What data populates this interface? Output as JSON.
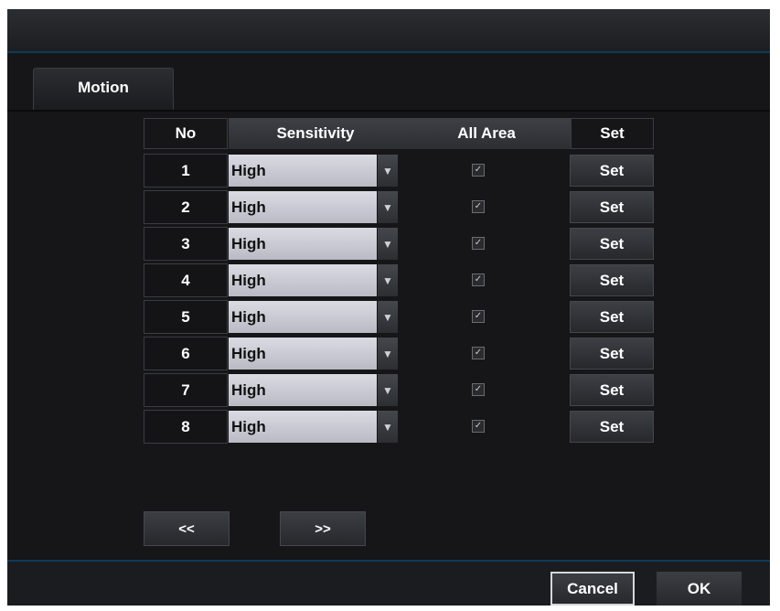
{
  "tab": {
    "label": "Motion"
  },
  "table": {
    "headers": {
      "no": "No",
      "sensitivity": "Sensitivity",
      "all_area": "All Area",
      "set": "Set"
    },
    "rows": [
      {
        "no": "1",
        "sensitivity": "High",
        "all_area": true,
        "set_label": "Set"
      },
      {
        "no": "2",
        "sensitivity": "High",
        "all_area": true,
        "set_label": "Set"
      },
      {
        "no": "3",
        "sensitivity": "High",
        "all_area": true,
        "set_label": "Set"
      },
      {
        "no": "4",
        "sensitivity": "High",
        "all_area": true,
        "set_label": "Set"
      },
      {
        "no": "5",
        "sensitivity": "High",
        "all_area": true,
        "set_label": "Set"
      },
      {
        "no": "6",
        "sensitivity": "High",
        "all_area": true,
        "set_label": "Set"
      },
      {
        "no": "7",
        "sensitivity": "High",
        "all_area": true,
        "set_label": "Set"
      },
      {
        "no": "8",
        "sensitivity": "High",
        "all_area": true,
        "set_label": "Set"
      }
    ]
  },
  "pagination": {
    "prev_label": "<<",
    "next_label": ">>"
  },
  "footer": {
    "cancel_label": "Cancel",
    "ok_label": "OK"
  },
  "icons": {
    "dropdown": "chevron-down-icon",
    "checkbox": "checkbox-checked-icon"
  },
  "colors": {
    "background": "#161618",
    "accent_line": "#0d3a5c",
    "select_bg": "#c9cad2"
  }
}
